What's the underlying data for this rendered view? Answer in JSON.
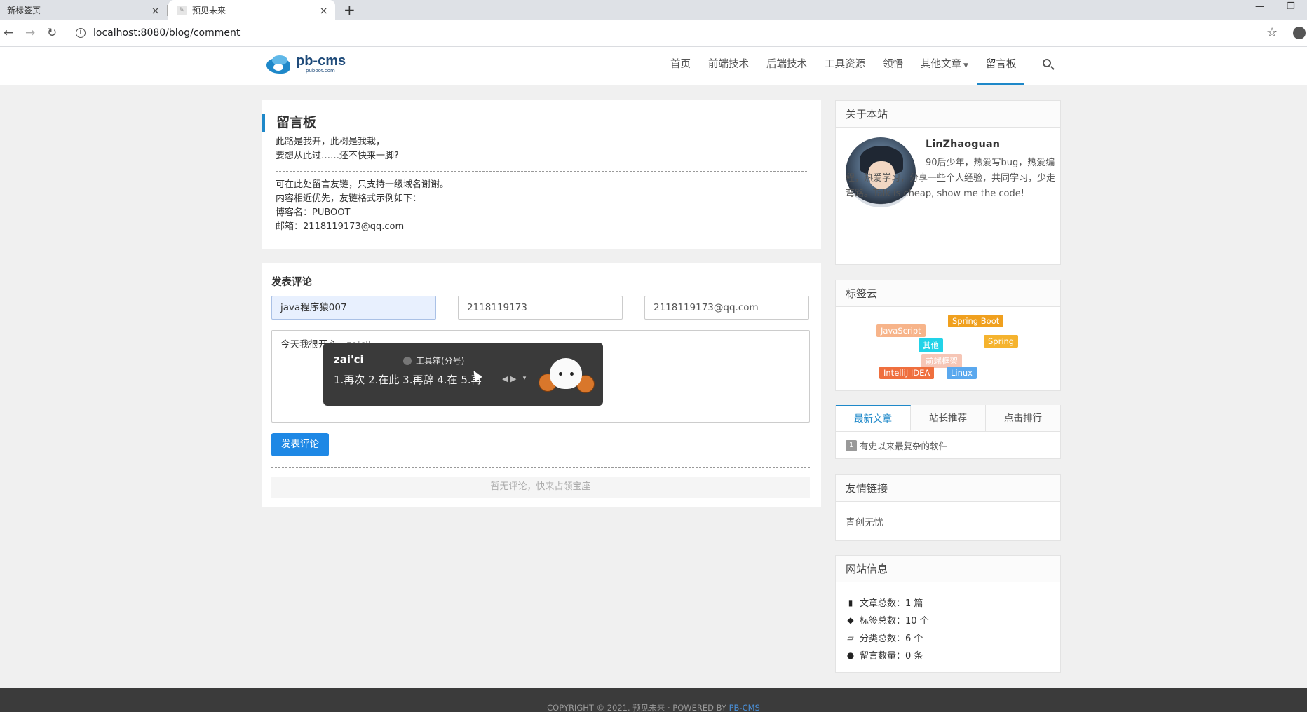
{
  "browser": {
    "tabs": [
      {
        "title": "新标签页",
        "active": false
      },
      {
        "title": "预见未来",
        "active": true
      }
    ],
    "url": "localhost:8080/blog/comment"
  },
  "site": {
    "logo_name": "pb-cms",
    "logo_sub": "puboot.com",
    "nav": [
      "首页",
      "前端技术",
      "后端技术",
      "工具资源",
      "领悟",
      "其他文章",
      "留言板"
    ],
    "active_nav": "留言板"
  },
  "board": {
    "title": "留言板",
    "lines": [
      "此路是我开，此树是我栽，",
      "要想从此过……还不快来一脚?"
    ],
    "info_lines": [
      "可在此处留言友链，只支持一级域名谢谢。",
      "内容相近优先，友链格式示例如下：",
      "博客名：PUBOOT",
      "邮箱：2118119173@qq.com"
    ]
  },
  "comment_form": {
    "title": "发表评论",
    "nickname": "java程序猿007",
    "qq": "2118119173",
    "email": "2118119173@qq.com",
    "content": "今天我很开心，zaici",
    "submit_label": "发表评论",
    "empty_hint": "暂无评论，快来占领宝座"
  },
  "ime": {
    "pinyin": "zai'ci",
    "toolbox": "工具箱(分号)",
    "candidates": "1.再次  2.在此  3.再辞  4.在  5.再"
  },
  "about": {
    "header": "关于本站",
    "name": "LinZhaoguan",
    "desc": "90后少年，热爱写bug，热爱编程，热爱学习，分享一些个人经验，共同学习，少走弯路。Talk is cheap, show me the code!"
  },
  "tagcloud": {
    "header": "标签云",
    "tags": [
      {
        "label": "Spring Boot",
        "color": "#f0a01e"
      },
      {
        "label": "JavaScript",
        "color": "#f7b48a"
      },
      {
        "label": "其他",
        "color": "#22d3e8"
      },
      {
        "label": "Spring",
        "color": "#f5b32e"
      },
      {
        "label": "前端框架",
        "color": "#f6c6b6"
      },
      {
        "label": "IntelliJ IDEA",
        "color": "#ef6f3e"
      },
      {
        "label": "Linux",
        "color": "#5aa8ee"
      }
    ]
  },
  "side_tabs": {
    "tabs": [
      "最新文章",
      "站长推荐",
      "点击排行"
    ],
    "active": "最新文章",
    "items": [
      {
        "rank": "1",
        "title": "有史以来最复杂的软件"
      }
    ]
  },
  "friend_links": {
    "header": "友情链接",
    "items": [
      "青创无忧"
    ]
  },
  "site_info": {
    "header": "网站信息",
    "rows": [
      {
        "icon": "file-icon",
        "label": "文章总数：",
        "value": "1 篇"
      },
      {
        "icon": "tags-icon",
        "label": "标签总数：",
        "value": "10 个"
      },
      {
        "icon": "folder-icon",
        "label": "分类总数：",
        "value": "6 个"
      },
      {
        "icon": "comments-icon",
        "label": "留言数量：",
        "value": "0 条"
      }
    ]
  },
  "footer": {
    "copyright": "COPYRIGHT © 2021. 预见未来 · POWERED BY ",
    "brand": "PB-CMS"
  }
}
